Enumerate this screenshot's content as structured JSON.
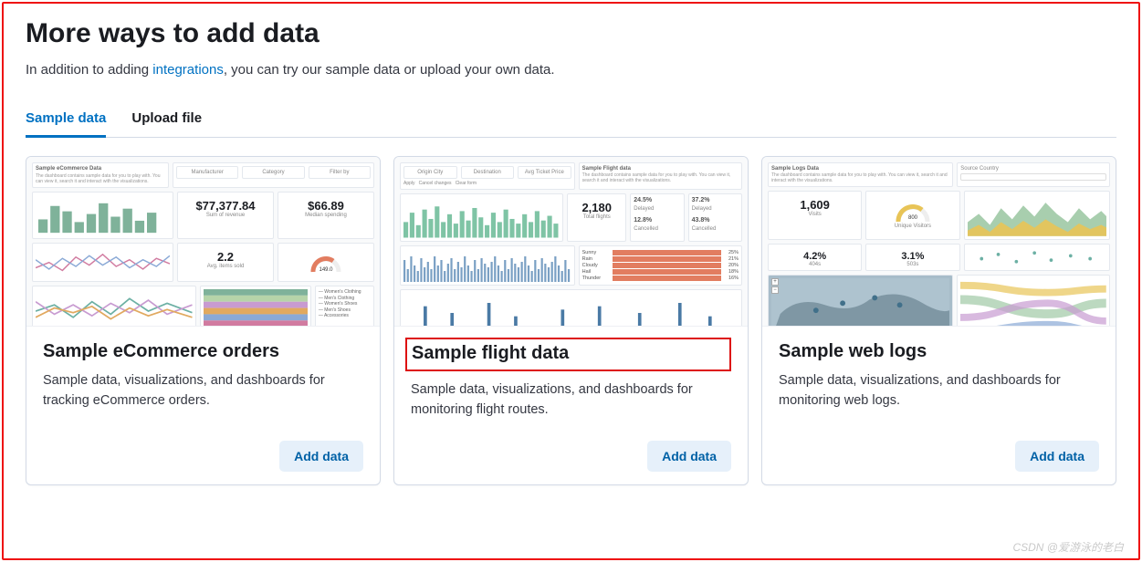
{
  "page_title": "More ways to add data",
  "intro_prefix": "In addition to adding ",
  "intro_link": "integrations",
  "intro_suffix": ", you can try our sample data or upload your own data.",
  "tabs": [
    {
      "label": "Sample data",
      "active": true
    },
    {
      "label": "Upload file",
      "active": false
    }
  ],
  "cards": [
    {
      "title": "Sample eCommerce orders",
      "desc": "Sample data, visualizations, and dashboards for tracking eCommerce orders.",
      "button": "Add data",
      "highlighted": false,
      "preview": {
        "header": "Sample eCommerce Data",
        "stat1_value": "$77,377.84",
        "stat1_label": "Sum of revenue",
        "stat2_value": "$66.89",
        "stat2_label": "Median spending",
        "stat3_value": "2.2",
        "stat3_label": "Avg. items sold",
        "gauge_value": "149.0"
      }
    },
    {
      "title": "Sample flight data",
      "desc": "Sample data, visualizations, and dashboards for monitoring flight routes.",
      "button": "Add data",
      "highlighted": true,
      "preview": {
        "header": "Sample Flight data",
        "stat1_value": "2,180",
        "stat1_label": "Total flights",
        "pair_a_value": "24.5%",
        "pair_a_label": "Delayed",
        "pair_b_value": "12.8%",
        "pair_b_label": "Cancelled",
        "pair_c_value": "37.2%",
        "pair_c_label": "Delayed",
        "pair_d_value": "43.8%",
        "pair_d_label": "Cancelled",
        "bars": [
          {
            "label": "Sunny",
            "pct": "25%"
          },
          {
            "label": "Rain",
            "pct": "21%"
          },
          {
            "label": "Cloudy",
            "pct": "20%"
          },
          {
            "label": "Hail",
            "pct": "18%"
          },
          {
            "label": "Thunder",
            "pct": "16%"
          }
        ]
      }
    },
    {
      "title": "Sample web logs",
      "desc": "Sample data, visualizations, and dashboards for monitoring web logs.",
      "button": "Add data",
      "highlighted": false,
      "preview": {
        "header": "Sample Logs Data",
        "stat1_value": "1,609",
        "stat1_label": "Visits",
        "gauge_value": "800",
        "gauge_label": "Unique Visitors",
        "stat2_value": "4.2%",
        "stat2_label": "404s",
        "stat3_value": "3.1%",
        "stat3_label": "503s"
      }
    }
  ],
  "watermark": "CSDN @爱游泳的老白"
}
